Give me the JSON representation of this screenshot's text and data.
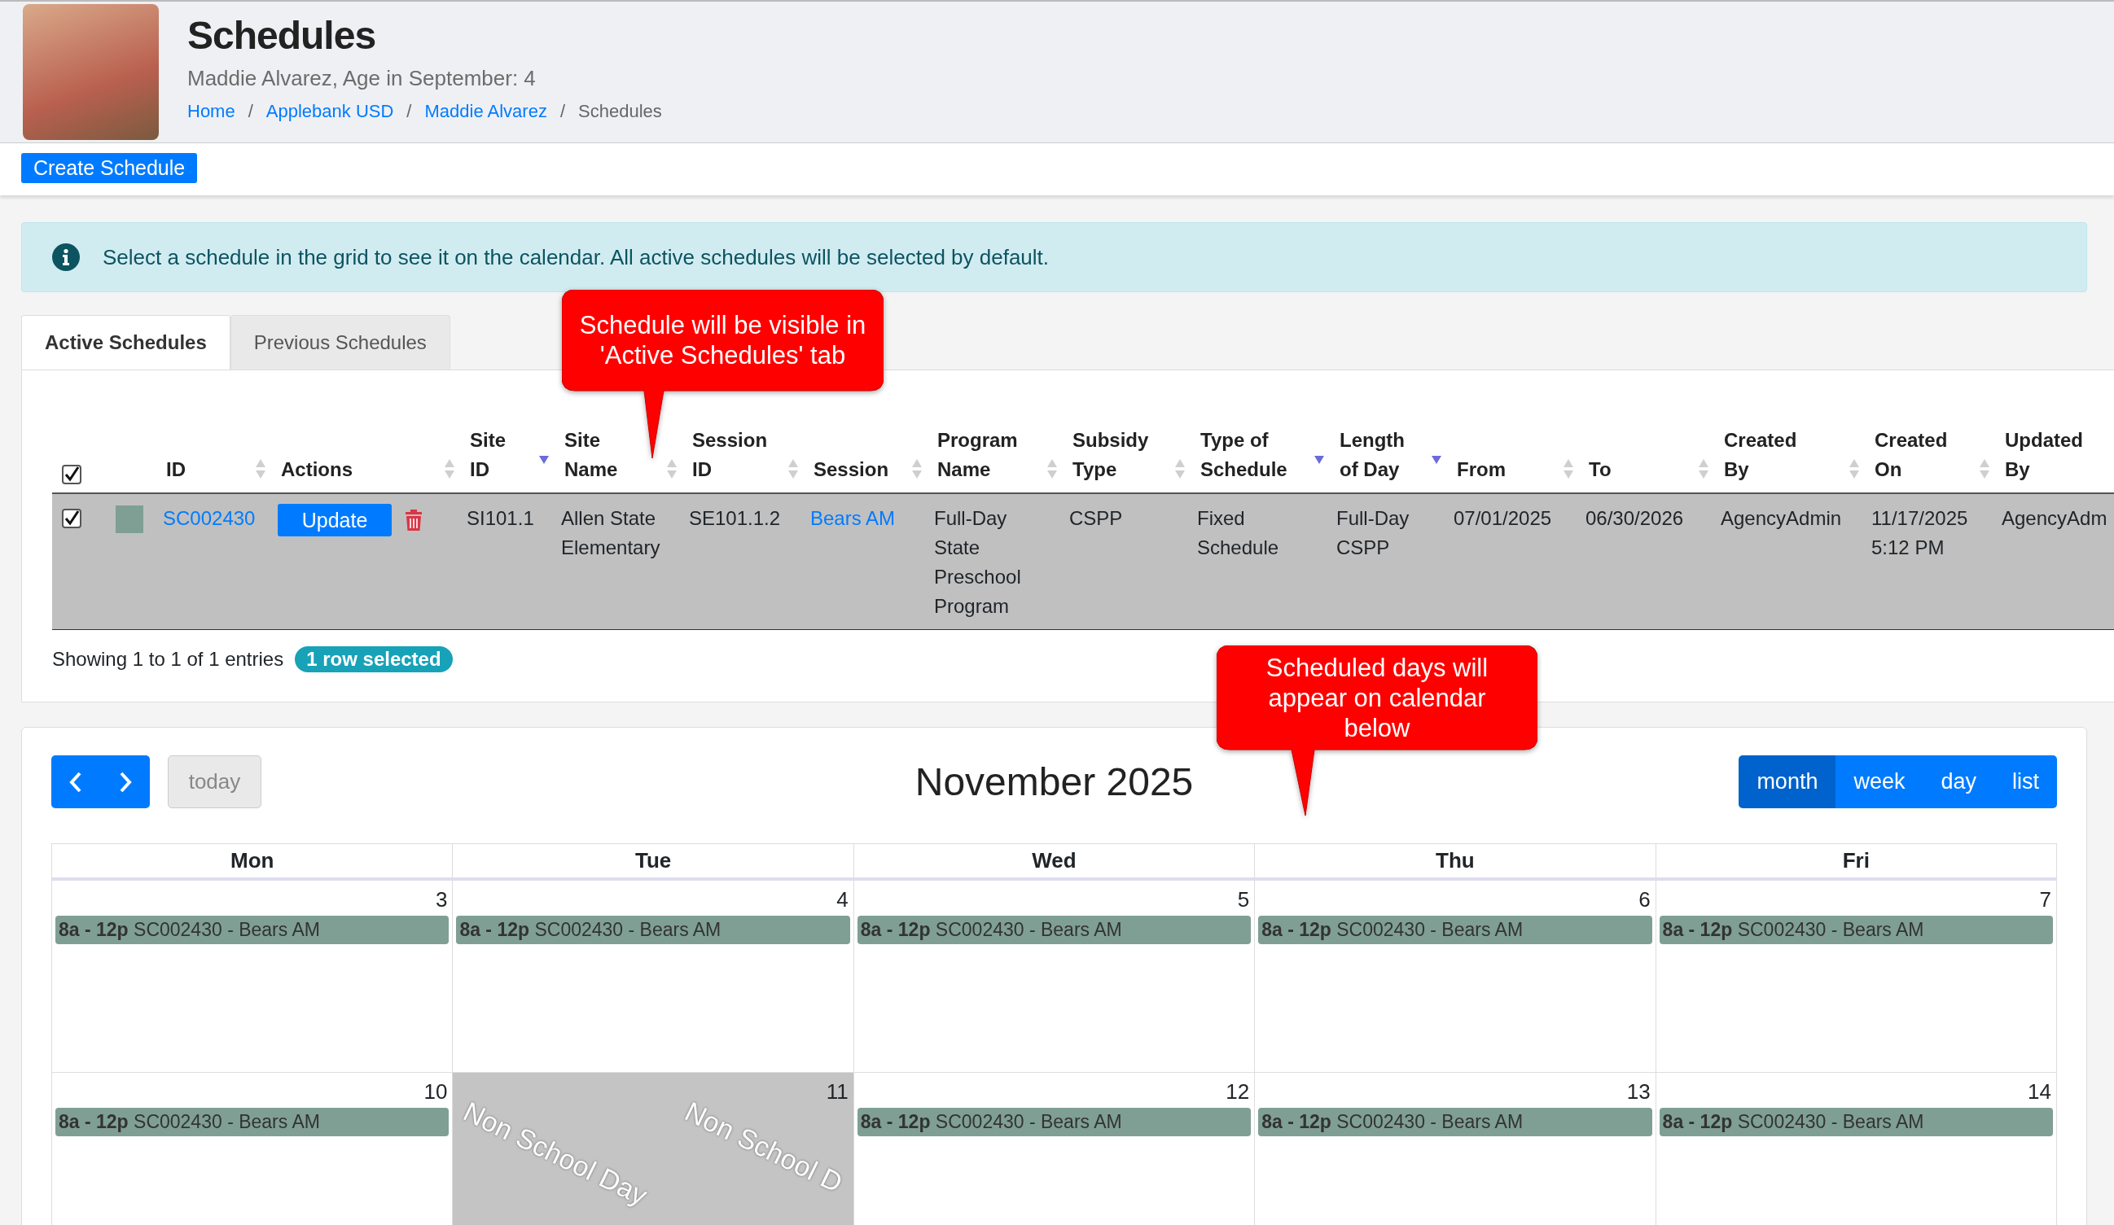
{
  "header": {
    "title": "Schedules",
    "subtitle": "Maddie Alvarez, Age in September: 4",
    "breadcrumbs": [
      {
        "label": "Home",
        "kind": "link"
      },
      {
        "label": "/",
        "kind": "separator"
      },
      {
        "label": "Applebank USD",
        "kind": "link"
      },
      {
        "label": "/",
        "kind": "separator"
      },
      {
        "label": "Maddie Alvarez",
        "kind": "link"
      },
      {
        "label": "/",
        "kind": "separator"
      },
      {
        "label": "Schedules",
        "kind": "current"
      }
    ]
  },
  "toolbar": {
    "create_button": "Create Schedule"
  },
  "alert": {
    "text": "Select a schedule in the grid to see it on the calendar. All active schedules will be selected by default."
  },
  "tabs": [
    {
      "label": "Active Schedules",
      "selected": true
    },
    {
      "label": "Previous Schedules",
      "selected": false
    }
  ],
  "table": {
    "select_all_checked": true,
    "columns": [
      {
        "label": "ID",
        "sortable": true,
        "sorted_desc": false
      },
      {
        "label": "Actions",
        "sortable": true,
        "sorted_desc": false
      },
      {
        "label": "Site ID",
        "sortable": true,
        "sorted_desc": true
      },
      {
        "label": "Site Name",
        "sortable": true,
        "sorted_desc": false
      },
      {
        "label": "Session ID",
        "sortable": true,
        "sorted_desc": false
      },
      {
        "label": "Session",
        "sortable": true,
        "sorted_desc": false
      },
      {
        "label": "Program Name",
        "sortable": true,
        "sorted_desc": false
      },
      {
        "label": "Subsidy Type",
        "sortable": true,
        "sorted_desc": false
      },
      {
        "label": "Type of Schedule",
        "sortable": true,
        "sorted_desc": true
      },
      {
        "label": "Length of Day",
        "sortable": true,
        "sorted_desc": true
      },
      {
        "label": "From",
        "sortable": true,
        "sorted_desc": false
      },
      {
        "label": "To",
        "sortable": true,
        "sorted_desc": false
      },
      {
        "label": "Created By",
        "sortable": true,
        "sorted_desc": false
      },
      {
        "label": "Created On",
        "sortable": true,
        "sorted_desc": false
      },
      {
        "label": "Updated By",
        "sortable": false
      }
    ],
    "rows": [
      {
        "selected": true,
        "checked": true,
        "color": "#7f9f94",
        "cells": [
          {
            "text": "SC002430",
            "kind": "link"
          },
          {
            "text": "Update",
            "kind": "actions"
          },
          {
            "text": "SI101.1",
            "kind": "text"
          },
          {
            "text": "Allen State Elementary",
            "kind": "text"
          },
          {
            "text": "SE101.1.2",
            "kind": "text"
          },
          {
            "text": "Bears AM",
            "kind": "link"
          },
          {
            "text": "Full-Day State Preschool Program",
            "kind": "text"
          },
          {
            "text": "CSPP",
            "kind": "text"
          },
          {
            "text": "Fixed Schedule",
            "kind": "text"
          },
          {
            "text": "Full-Day CSPP",
            "kind": "text"
          },
          {
            "text": "07/01/2025",
            "kind": "text"
          },
          {
            "text": "06/30/2026",
            "kind": "text"
          },
          {
            "text": "AgencyAdmin",
            "kind": "text"
          },
          {
            "text": "11/17/2025 5:12 PM",
            "kind": "text"
          },
          {
            "text": "AgencyAdm",
            "kind": "text"
          }
        ]
      }
    ],
    "info": "Showing 1 to 1 of 1 entries",
    "badge": "1 row selected"
  },
  "callouts": [
    {
      "text": "Schedule will be visible in 'Active Schedules' tab"
    },
    {
      "text": "Scheduled days will appear on calendar below"
    }
  ],
  "calendar": {
    "title": "November 2025",
    "today_button": "today",
    "today_disabled": true,
    "views": [
      {
        "label": "month",
        "selected": true
      },
      {
        "label": "week",
        "selected": false
      },
      {
        "label": "day",
        "selected": false
      },
      {
        "label": "list",
        "selected": false
      }
    ],
    "weekdays": [
      "Mon",
      "Tue",
      "Wed",
      "Thu",
      "Fri"
    ],
    "weeks": [
      {
        "days": [
          {
            "date": "3",
            "non_school": false,
            "events": [
              {
                "text": "**8a - 12p** SC002430 - Bears AM",
                "color": "#7f9f94"
              }
            ]
          },
          {
            "date": "4",
            "non_school": false,
            "events": [
              {
                "text": "**8a - 12p** SC002430 - Bears AM",
                "color": "#7f9f94"
              }
            ]
          },
          {
            "date": "5",
            "non_school": false,
            "events": [
              {
                "text": "**8a - 12p** SC002430 - Bears AM",
                "color": "#7f9f94"
              }
            ]
          },
          {
            "date": "6",
            "non_school": false,
            "events": [
              {
                "text": "**8a - 12p** SC002430 - Bears AM",
                "color": "#7f9f94"
              }
            ]
          },
          {
            "date": "7",
            "non_school": false,
            "events": [
              {
                "text": "**8a - 12p** SC002430 - Bears AM",
                "color": "#7f9f94"
              }
            ]
          }
        ]
      },
      {
        "days": [
          {
            "date": "10",
            "non_school": false,
            "events": [
              {
                "text": "**8a - 12p** SC002430 - Bears AM",
                "color": "#7f9f94"
              }
            ]
          },
          {
            "date": "11",
            "non_school": true,
            "non_school_labels": [
              "Non School Day",
              "Non School D"
            ]
          },
          {
            "date": "12",
            "non_school": false,
            "events": [
              {
                "text": "**8a - 12p** SC002430 - Bears AM",
                "color": "#7f9f94"
              }
            ]
          },
          {
            "date": "13",
            "non_school": false,
            "events": [
              {
                "text": "**8a - 12p** SC002430 - Bears AM",
                "color": "#7f9f94"
              }
            ]
          },
          {
            "date": "14",
            "non_school": false,
            "events": [
              {
                "text": "**8a - 12p** SC002430 - Bears AM",
                "color": "#7f9f94"
              }
            ]
          }
        ]
      }
    ]
  }
}
